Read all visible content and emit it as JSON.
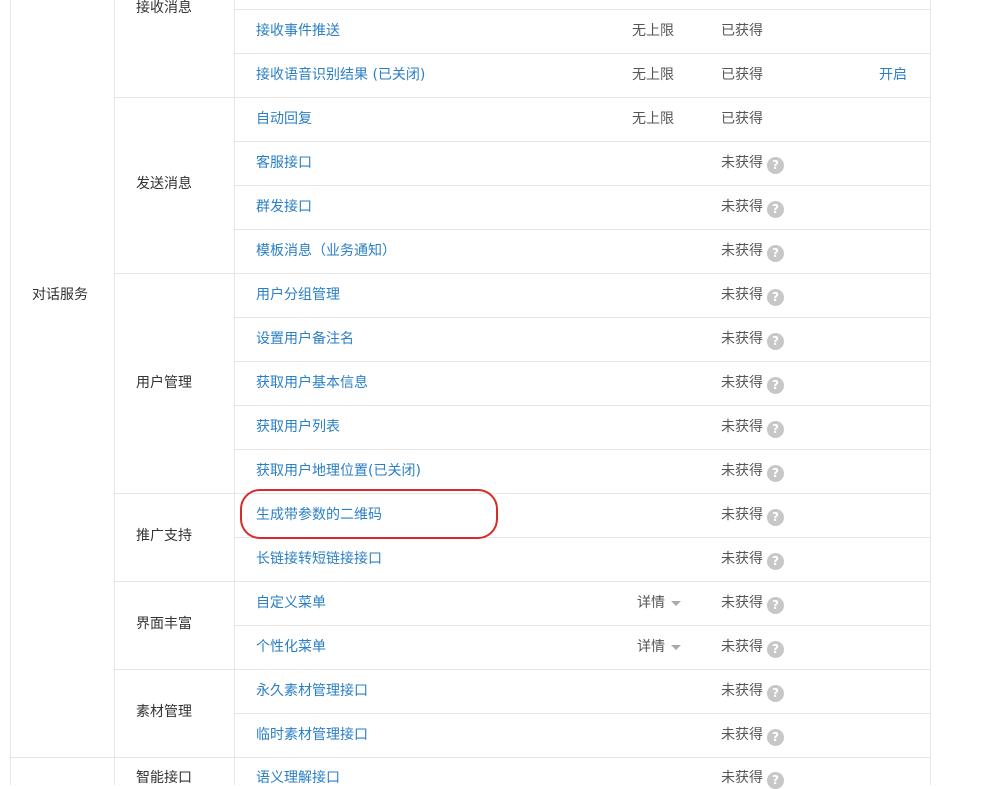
{
  "category": "对话服务",
  "groups": {
    "receive": "接收消息",
    "send": "发送消息",
    "user": "用户管理",
    "promo": "推广支持",
    "ui": "界面丰富",
    "material": "素材管理",
    "smart": "智能接口"
  },
  "rows": [
    {
      "name": "接收事件推送",
      "limit": "无上限",
      "status": "已获得",
      "action": ""
    },
    {
      "name": "接收语音识别结果 (已关闭)",
      "limit": "无上限",
      "status": "已获得",
      "action": "开启"
    },
    {
      "name": "自动回复",
      "limit": "无上限",
      "status": "已获得",
      "action": ""
    },
    {
      "name": "客服接口",
      "limit": "",
      "status": "未获得",
      "action": ""
    },
    {
      "name": "群发接口",
      "limit": "",
      "status": "未获得",
      "action": ""
    },
    {
      "name": "模板消息（业务通知）",
      "limit": "",
      "status": "未获得",
      "action": ""
    },
    {
      "name": "用户分组管理",
      "limit": "",
      "status": "未获得",
      "action": ""
    },
    {
      "name": "设置用户备注名",
      "limit": "",
      "status": "未获得",
      "action": ""
    },
    {
      "name": "获取用户基本信息",
      "limit": "",
      "status": "未获得",
      "action": ""
    },
    {
      "name": "获取用户列表",
      "limit": "",
      "status": "未获得",
      "action": ""
    },
    {
      "name": "获取用户地理位置(已关闭)",
      "limit": "",
      "status": "未获得",
      "action": ""
    },
    {
      "name": "生成带参数的二维码",
      "limit": "",
      "status": "未获得",
      "action": ""
    },
    {
      "name": "长链接转短链接接口",
      "limit": "",
      "status": "未获得",
      "action": ""
    },
    {
      "name": "自定义菜单",
      "limit": "详情",
      "status": "未获得",
      "action": ""
    },
    {
      "name": "个性化菜单",
      "limit": "详情",
      "status": "未获得",
      "action": ""
    },
    {
      "name": "永久素材管理接口",
      "limit": "",
      "status": "未获得",
      "action": ""
    },
    {
      "name": "临时素材管理接口",
      "limit": "",
      "status": "未获得",
      "action": ""
    },
    {
      "name": "语义理解接口",
      "limit": "",
      "status": "未获得",
      "action": ""
    }
  ],
  "help_glyph": "?",
  "colors": {
    "link": "#2a7fc6",
    "highlight": "#d92a2a",
    "border": "#e6e6e6"
  }
}
